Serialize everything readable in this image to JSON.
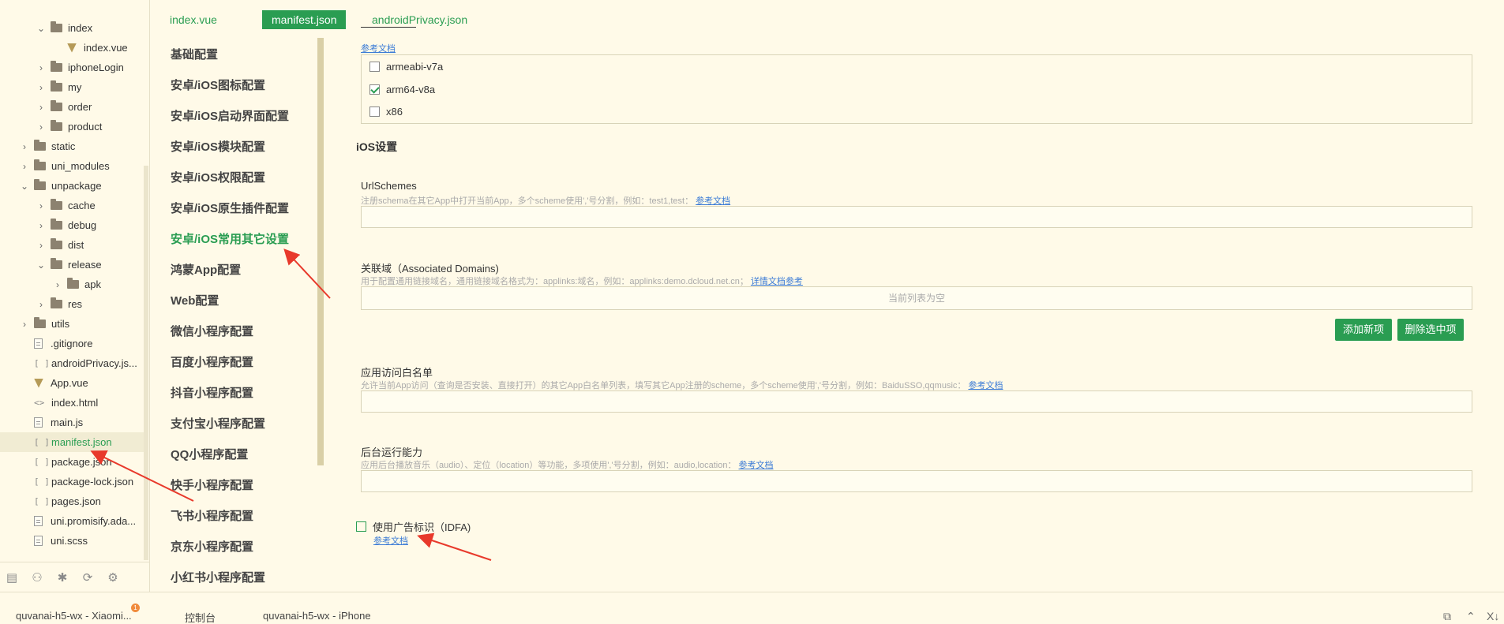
{
  "tree": {
    "items": [
      {
        "label": "index",
        "chev": "⌄",
        "type": "folder"
      },
      {
        "label": "index.vue",
        "chev": "",
        "type": "file"
      },
      {
        "label": "iphoneLogin",
        "chev": "›",
        "type": "folder"
      },
      {
        "label": "my",
        "chev": "›",
        "type": "folder"
      },
      {
        "label": "order",
        "chev": "›",
        "type": "folder"
      },
      {
        "label": "product",
        "chev": "›",
        "type": "folder"
      },
      {
        "label": "static",
        "chev": "›",
        "type": "folder"
      },
      {
        "label": "uni_modules",
        "chev": "›",
        "type": "folder"
      },
      {
        "label": "unpackage",
        "chev": "⌄",
        "type": "folder"
      },
      {
        "label": "cache",
        "chev": "›",
        "type": "folder"
      },
      {
        "label": "debug",
        "chev": "›",
        "type": "folder"
      },
      {
        "label": "dist",
        "chev": "›",
        "type": "folder"
      },
      {
        "label": "release",
        "chev": "⌄",
        "type": "folder"
      },
      {
        "label": "apk",
        "chev": "›",
        "type": "folder"
      },
      {
        "label": "res",
        "chev": "›",
        "type": "folder"
      },
      {
        "label": "utils",
        "chev": "›",
        "type": "folder"
      },
      {
        "label": ".gitignore",
        "chev": "",
        "type": "file"
      },
      {
        "label": "androidPrivacy.js...",
        "chev": "",
        "type": "file"
      },
      {
        "label": "App.vue",
        "chev": "",
        "type": "file"
      },
      {
        "label": "index.html",
        "chev": "",
        "type": "file"
      },
      {
        "label": "main.js",
        "chev": "",
        "type": "file"
      },
      {
        "label": "manifest.json",
        "chev": "",
        "type": "file"
      },
      {
        "label": "package.json",
        "chev": "",
        "type": "file"
      },
      {
        "label": "package-lock.json",
        "chev": "",
        "type": "file"
      },
      {
        "label": "pages.json",
        "chev": "",
        "type": "file"
      },
      {
        "label": "uni.promisify.ada...",
        "chev": "",
        "type": "file"
      },
      {
        "label": "uni.scss",
        "chev": "",
        "type": "file"
      }
    ],
    "selected": "manifest.json"
  },
  "tabs": [
    "index.vue",
    "manifest.json",
    "androidPrivacy.json"
  ],
  "active_tab": "manifest.json",
  "config_nav": {
    "items": [
      "基础配置",
      "安卓/iOS图标配置",
      "安卓/iOS启动界面配置",
      "安卓/iOS模块配置",
      "安卓/iOS权限配置",
      "安卓/iOS原生插件配置",
      "安卓/iOS常用其它设置",
      "鸿蒙App配置",
      "Web配置",
      "微信小程序配置",
      "百度小程序配置",
      "抖音小程序配置",
      "支付宝小程序配置",
      "QQ小程序配置",
      "快手小程序配置",
      "飞书小程序配置",
      "京东小程序配置",
      "小红书小程序配置"
    ],
    "active": "安卓/iOS常用其它设置"
  },
  "content": {
    "top_link": "参考文档",
    "abi_options": [
      {
        "label": "armeabi-v7a",
        "checked": false
      },
      {
        "label": "arm64-v8a",
        "checked": true
      },
      {
        "label": "x86",
        "checked": false
      }
    ],
    "ios_section_title": "iOS设置",
    "url_schemes": {
      "label": "UrlSchemes",
      "desc": "注册schema在其它App中打开当前App，多个scheme使用','号分割，例如：test1,test：",
      "link": "参考文档",
      "value": ""
    },
    "associated_domains": {
      "label": "关联域（Associated Domains)",
      "desc": "用于配置通用链接域名，通用链接域名格式为：applinks:域名，例如：applinks:demo.dcloud.net.cn；",
      "link": "详情文档参考",
      "empty_text": "当前列表为空",
      "add_button": "添加新项",
      "delete_button": "删除选中项"
    },
    "whitelist": {
      "label": "应用访问白名单",
      "desc": "允许当前App访问（查询是否安装、直接打开）的其它App白名单列表，填写其它App注册的scheme，多个scheme使用','号分割，例如：BaiduSSO,qqmusic：",
      "link": "参考文档",
      "value": ""
    },
    "background": {
      "label": "后台运行能力",
      "desc": "应用后台播放音乐（audio）、定位（location）等功能，多项使用','号分割，例如：audio,location：",
      "link": "参考文档",
      "value": ""
    },
    "idfa": {
      "label": "使用广告标识（IDFA)",
      "checked": false,
      "link": "参考文档"
    }
  },
  "statusbar": {
    "device1": "quvanai-h5-wx - Xiaomi...",
    "badge": "1",
    "console": "控制台",
    "device2": "quvanai-h5-wx - iPhone",
    "close_glyph": "X↓"
  },
  "colors": {
    "accent": "#2a9d52",
    "background": "#fffae8",
    "link": "#3b7bd6",
    "annotation": "#e8392b"
  }
}
